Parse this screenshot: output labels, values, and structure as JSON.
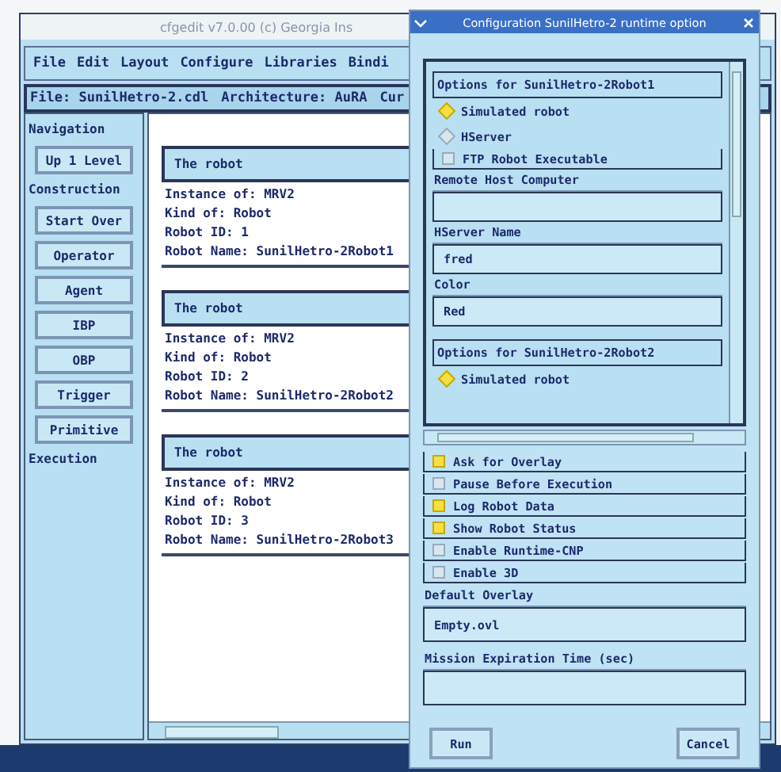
{
  "main_window": {
    "title": "cfgedit v7.0.00 (c) Georgia Ins",
    "menu": [
      "File",
      "Edit",
      "Layout",
      "Configure",
      "Libraries",
      "Bindi"
    ],
    "file_info": [
      "File: SunilHetro-2.cdl",
      "Architecture: AuRA",
      "Cur"
    ],
    "sidebar": [
      {
        "kind": "heading",
        "label": "Navigation"
      },
      {
        "kind": "button",
        "label": "Up 1 Level"
      },
      {
        "kind": "heading",
        "label": "Construction"
      },
      {
        "kind": "button",
        "label": "Start Over"
      },
      {
        "kind": "button",
        "label": "Operator"
      },
      {
        "kind": "button",
        "label": "Agent"
      },
      {
        "kind": "button",
        "label": "IBP"
      },
      {
        "kind": "button",
        "label": "OBP"
      },
      {
        "kind": "button",
        "label": "Trigger"
      },
      {
        "kind": "button",
        "label": "Primitive"
      },
      {
        "kind": "heading",
        "label": "Execution"
      }
    ],
    "robots": [
      {
        "title": "The robot",
        "lines": [
          "Instance of: MRV2",
          "Kind of: Robot",
          "Robot ID: 1",
          "Robot Name: SunilHetro-2Robot1"
        ]
      },
      {
        "title": "The robot",
        "lines": [
          "Instance of: MRV2",
          "Kind of: Robot",
          "Robot ID: 2",
          "Robot Name: SunilHetro-2Robot2"
        ]
      },
      {
        "title": "The robot",
        "lines": [
          "Instance of: MRV2",
          "Kind of: Robot",
          "Robot ID: 3",
          "Robot Name: SunilHetro-2Robot3"
        ]
      }
    ]
  },
  "dialog": {
    "title": "Configuration SunilHetro-2 runtime option",
    "robot_options": [
      {
        "heading": "Options for SunilHetro-2Robot1",
        "items": [
          {
            "kind": "radio",
            "label": "Simulated robot",
            "selected": true
          },
          {
            "kind": "radio",
            "label": "HServer",
            "selected": false
          },
          {
            "kind": "checkbox",
            "label": "FTP Robot Executable",
            "checked": false
          },
          {
            "kind": "field",
            "label": "Remote Host Computer"
          },
          {
            "kind": "field",
            "label": "HServer Name",
            "value": "fred"
          },
          {
            "kind": "field",
            "label": "Color",
            "value": "Red"
          }
        ]
      },
      {
        "heading": "Options for SunilHetro-2Robot2",
        "items": [
          {
            "kind": "radio",
            "label": "Simulated robot",
            "selected": true
          }
        ]
      }
    ],
    "options": [
      {
        "label": "Ask for Overlay",
        "checked": true
      },
      {
        "label": "Pause Before Execution",
        "checked": false
      },
      {
        "label": "Log Robot Data",
        "checked": true
      },
      {
        "label": "Show Robot Status",
        "checked": true
      },
      {
        "label": "Enable Runtime-CNP",
        "checked": false
      },
      {
        "label": "Enable 3D",
        "checked": false
      }
    ],
    "fields": [
      {
        "label": "Default Overlay",
        "value": "Empty.ovl"
      },
      {
        "label": "Mission Expiration Time (sec)"
      }
    ],
    "buttons": [
      "Run",
      "Cancel"
    ]
  }
}
